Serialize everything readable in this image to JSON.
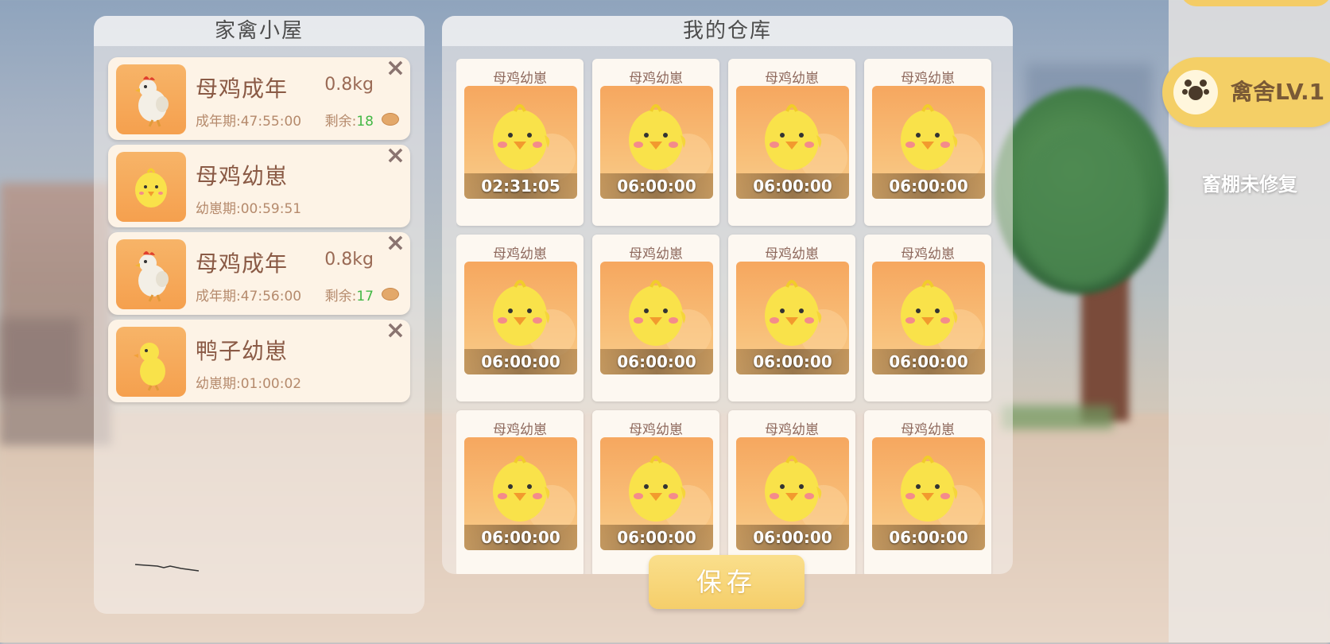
{
  "house_panel": {
    "title": "家禽小屋",
    "items": [
      {
        "name": "母鸡成年",
        "weight": "0.8kg",
        "time": "成年期:47:55:00",
        "remain_label": "剩余:",
        "remain_count": "18",
        "animal": "hen"
      },
      {
        "name": "母鸡幼崽",
        "weight": "",
        "time": "幼崽期:00:59:51",
        "remain_label": "",
        "remain_count": "",
        "animal": "chick"
      },
      {
        "name": "母鸡成年",
        "weight": "0.8kg",
        "time": "成年期:47:56:00",
        "remain_label": "剩余:",
        "remain_count": "17",
        "animal": "hen"
      },
      {
        "name": "鸭子幼崽",
        "weight": "",
        "time": "幼崽期:01:00:02",
        "remain_label": "",
        "remain_count": "",
        "animal": "duckling"
      }
    ],
    "close_icon": "×"
  },
  "storage_panel": {
    "title": "我的仓库",
    "slots": [
      {
        "label": "母鸡幼崽",
        "timer": "02:31:05"
      },
      {
        "label": "母鸡幼崽",
        "timer": "06:00:00"
      },
      {
        "label": "母鸡幼崽",
        "timer": "06:00:00"
      },
      {
        "label": "母鸡幼崽",
        "timer": "06:00:00"
      },
      {
        "label": "母鸡幼崽",
        "timer": "06:00:00"
      },
      {
        "label": "母鸡幼崽",
        "timer": "06:00:00"
      },
      {
        "label": "母鸡幼崽",
        "timer": "06:00:00"
      },
      {
        "label": "母鸡幼崽",
        "timer": "06:00:00"
      },
      {
        "label": "母鸡幼崽",
        "timer": "06:00:00"
      },
      {
        "label": "母鸡幼崽",
        "timer": "06:00:00"
      },
      {
        "label": "母鸡幼崽",
        "timer": "06:00:00"
      },
      {
        "label": "母鸡幼崽",
        "timer": "06:00:00"
      }
    ]
  },
  "save_button": {
    "label": "保存"
  },
  "sidebar": {
    "level_label": "禽舍LV.1",
    "status": "畜棚未修复"
  },
  "colors": {
    "accent": "#f4cf66",
    "remain_count": "#43b845",
    "card_bg": "#fdf3e6"
  }
}
